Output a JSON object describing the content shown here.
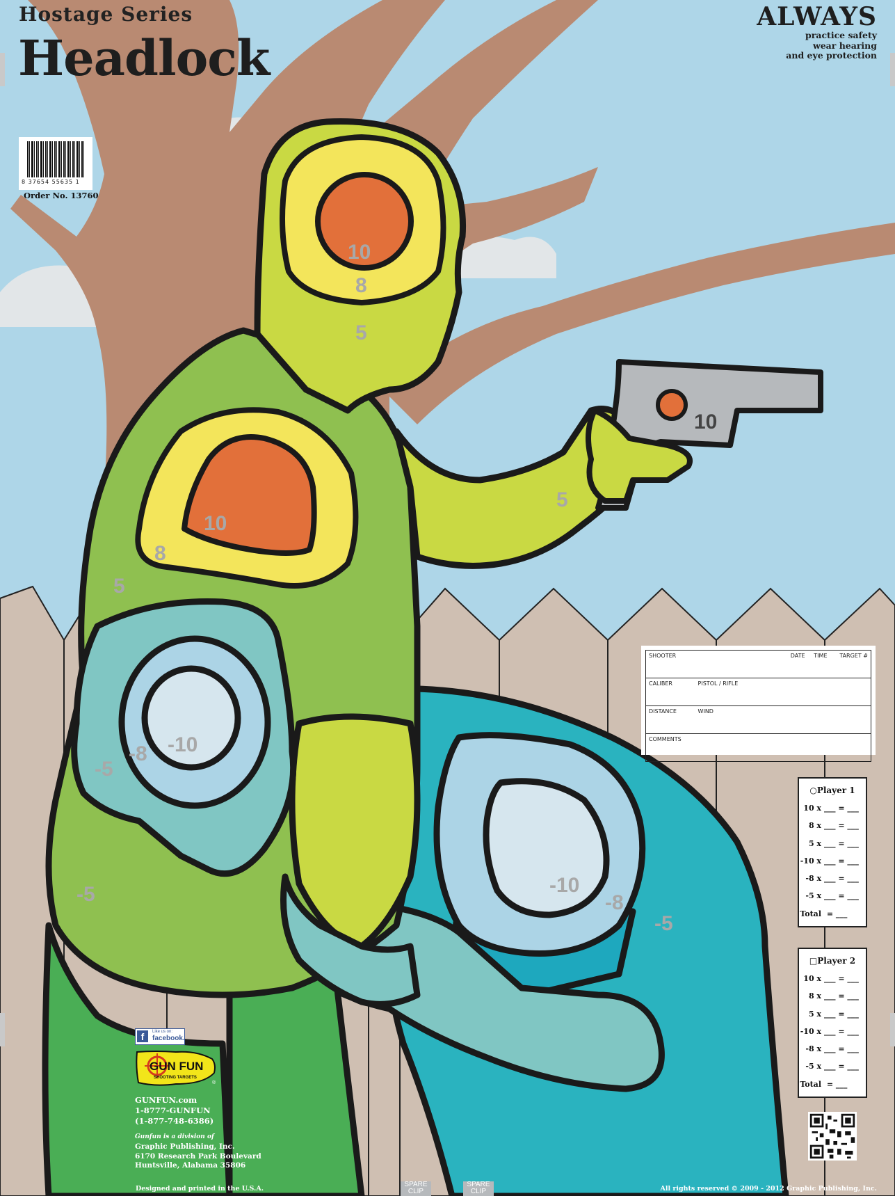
{
  "header": {
    "series": "Hostage Series",
    "title": "Headlock"
  },
  "safety": {
    "headline": "ALWAYS",
    "line1": "practice safety",
    "line2": "wear hearing",
    "line3": "and eye protection"
  },
  "barcode": {
    "digits": "8   37654   55635   1",
    "order": "Order No. 13760"
  },
  "scores": {
    "head_10": "10",
    "head_8": "8",
    "head_5": "5",
    "chest_10": "10",
    "chest_8": "8",
    "chest_5": "5",
    "gun_10": "10",
    "arm_5": "5",
    "hostage1_m10": "-10",
    "hostage1_m8": "-8",
    "hostage1_m5": "-5",
    "hostage1_body_m5": "-5",
    "hostage2_m10": "-10",
    "hostage2_m8": "-8",
    "hostage2_m5": "-5"
  },
  "info_card": {
    "shooter": "SHOOTER",
    "date": "DATE",
    "time": "TIME",
    "target": "TARGET #",
    "caliber": "CALIBER",
    "pistol_rifle": "PISTOL / RIFLE",
    "distance": "DISTANCE",
    "wind": "WIND",
    "comments": "COMMENTS"
  },
  "player1": {
    "title": "○Player 1",
    "rows": [
      {
        "label": "10 x",
        "rest": "___  = ___"
      },
      {
        "label": "8 x",
        "rest": "___  = ___"
      },
      {
        "label": "5 x",
        "rest": "___  = ___"
      },
      {
        "label": "-10 x",
        "rest": "___  = ___"
      },
      {
        "label": "-8 x",
        "rest": "___  = ___"
      },
      {
        "label": "-5 x",
        "rest": "___  = ___"
      },
      {
        "label": "Total",
        "rest": "    = ___"
      }
    ]
  },
  "player2": {
    "title": "□Player 2",
    "rows": [
      {
        "label": "10 x",
        "rest": "___  = ___"
      },
      {
        "label": "8 x",
        "rest": "___  = ___"
      },
      {
        "label": "5 x",
        "rest": "___  = ___"
      },
      {
        "label": "-10 x",
        "rest": "___  = ___"
      },
      {
        "label": "-8 x",
        "rest": "___  = ___"
      },
      {
        "label": "-5 x",
        "rest": "___  = ___"
      },
      {
        "label": "Total",
        "rest": "    = ___"
      }
    ]
  },
  "facebook": {
    "small": "Like us on:",
    "big": "facebook."
  },
  "logo": {
    "brand": "GUN FUN",
    "tagline": "SHOOTING TARGETS",
    "registered": "®"
  },
  "contact": {
    "web_brand": "GUNFUN",
    "web_tld": ".com",
    "phone1": "1-8777-GUNFUN",
    "phone2": "(1-877-748-6386)",
    "division": "Gunfun is a division of",
    "company": "Graphic Publishing, Inc.",
    "street": "6170 Research Park Boulevard",
    "city": " Huntsville, Alabama 35806"
  },
  "footer": {
    "left": "Designed and printed in the U.S.A.",
    "right": "All rights reserved © 2009 - 2012 Graphic Publishing, Inc."
  },
  "spare_clips": {
    "a": "SPARE CLIP",
    "b": "SPARE CLIP"
  },
  "clip_label": "CLIP",
  "colors": {
    "sky": "#aed6e8",
    "tree": "#b98a72",
    "fence": "#cfbfb2",
    "head_yellow_green": "#c9d943",
    "yellow": "#f3e55b",
    "orange": "#e2703a",
    "torso_green": "#8fc050",
    "pants_green": "#4aae55",
    "hostage_teal": "#80c6c3",
    "hostage_cyan": "#2ab3bf",
    "pale_blue": "#acd4e6",
    "gun_gray": "#b6b9bc"
  }
}
